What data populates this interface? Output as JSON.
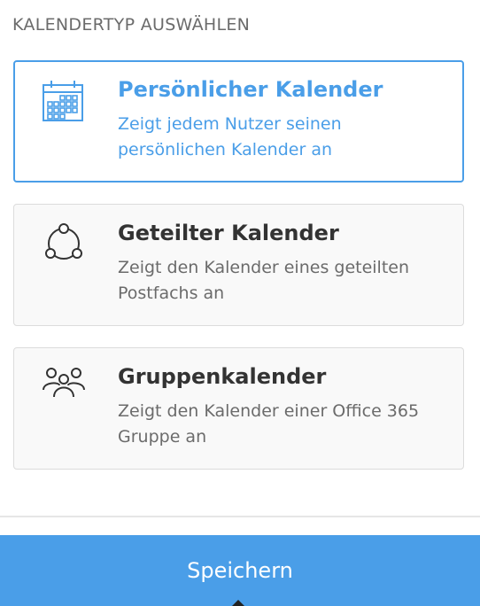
{
  "section_title": "KALENDERTYP AUSWÄHLEN",
  "options": [
    {
      "title": "Persönlicher Kalender",
      "description": "Zeigt jedem Nutzer seinen persönlichen Kalender an",
      "icon": "calendar-icon",
      "selected": true
    },
    {
      "title": "Geteilter Kalender",
      "description": "Zeigt den Kalender eines geteilten Postfachs an",
      "icon": "share-icon",
      "selected": false
    },
    {
      "title": "Gruppenkalender",
      "description": "Zeigt den Kalender einer Office 365 Gruppe an",
      "icon": "group-icon",
      "selected": false
    }
  ],
  "save_label": "Speichern",
  "colors": {
    "accent": "#4a9ee8",
    "text_dark": "#333333",
    "text_muted": "#6b6b6b",
    "card_background": "#f9f9f9",
    "card_border": "#dcdcdc"
  }
}
